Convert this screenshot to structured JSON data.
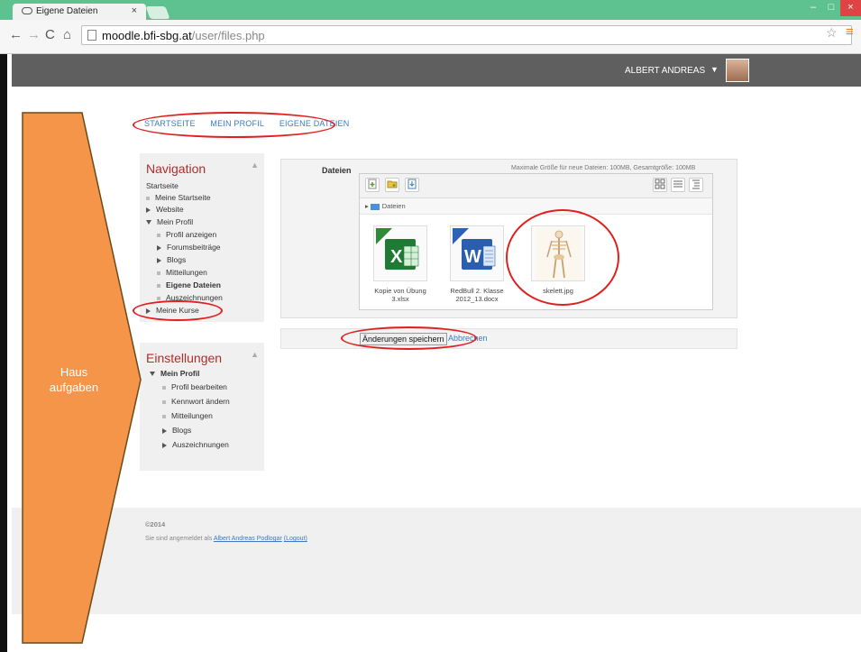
{
  "browser": {
    "tab_title": "Eigene Dateien",
    "tab_close": "×",
    "url_host": "moodle.bfi-sbg.at",
    "url_path": "/user/files.php",
    "win_min": "–",
    "win_max": "□",
    "win_close": "×"
  },
  "header": {
    "username": "ALBERT ANDREAS",
    "caret": "▼"
  },
  "breadcrumb": [
    "STARTSEITE",
    "MEIN PROFIL",
    "EIGENE DATEIEN"
  ],
  "navigation": {
    "title": "Navigation",
    "hide": "▲",
    "items": [
      "Startseite",
      "Meine Startseite",
      "Website",
      "Mein Profil",
      "Profil anzeigen",
      "Forumsbeiträge",
      "Blogs",
      "Mitteilungen",
      "Eigene Dateien",
      "Auszeichnungen",
      "Meine Kurse"
    ]
  },
  "settings": {
    "title": "Einstellungen",
    "hide": "▲",
    "items": [
      "Mein Profil",
      "Profil bearbeiten",
      "Kennwort ändern",
      "Mitteilungen",
      "Blogs",
      "Auszeichnungen"
    ]
  },
  "files": {
    "label": "Dateien",
    "max_size": "Maximale Größe für neue Dateien: 100MB, Gesamtgröße: 100MB",
    "path": "Dateien",
    "items": [
      {
        "name": "Kopie von Übung 3.xlsx",
        "icon": "excel-file-icon"
      },
      {
        "name": "RedBull 2. Klasse 2012_13.docx",
        "icon": "word-file-icon"
      },
      {
        "name": "skelett.jpg",
        "icon": "image-file-icon"
      }
    ]
  },
  "actions": {
    "save": "Änderungen speichern",
    "cancel": "Abbrechen"
  },
  "footer": {
    "copyright": "©2014",
    "logged_in_prefix": "Sie sind angemeldet als ",
    "user_link": "Albert Andreas Podlogar",
    "logout": "(Logout)"
  },
  "annotation": {
    "label": "Haus aufgaben"
  },
  "colors": {
    "titlebar": "#5ec290",
    "header": "#5f5f5f",
    "annotation_fill": "#f5954a",
    "annotation_circle": "#e02020",
    "block_title": "#b52a2a",
    "link": "#3b7bbf"
  }
}
